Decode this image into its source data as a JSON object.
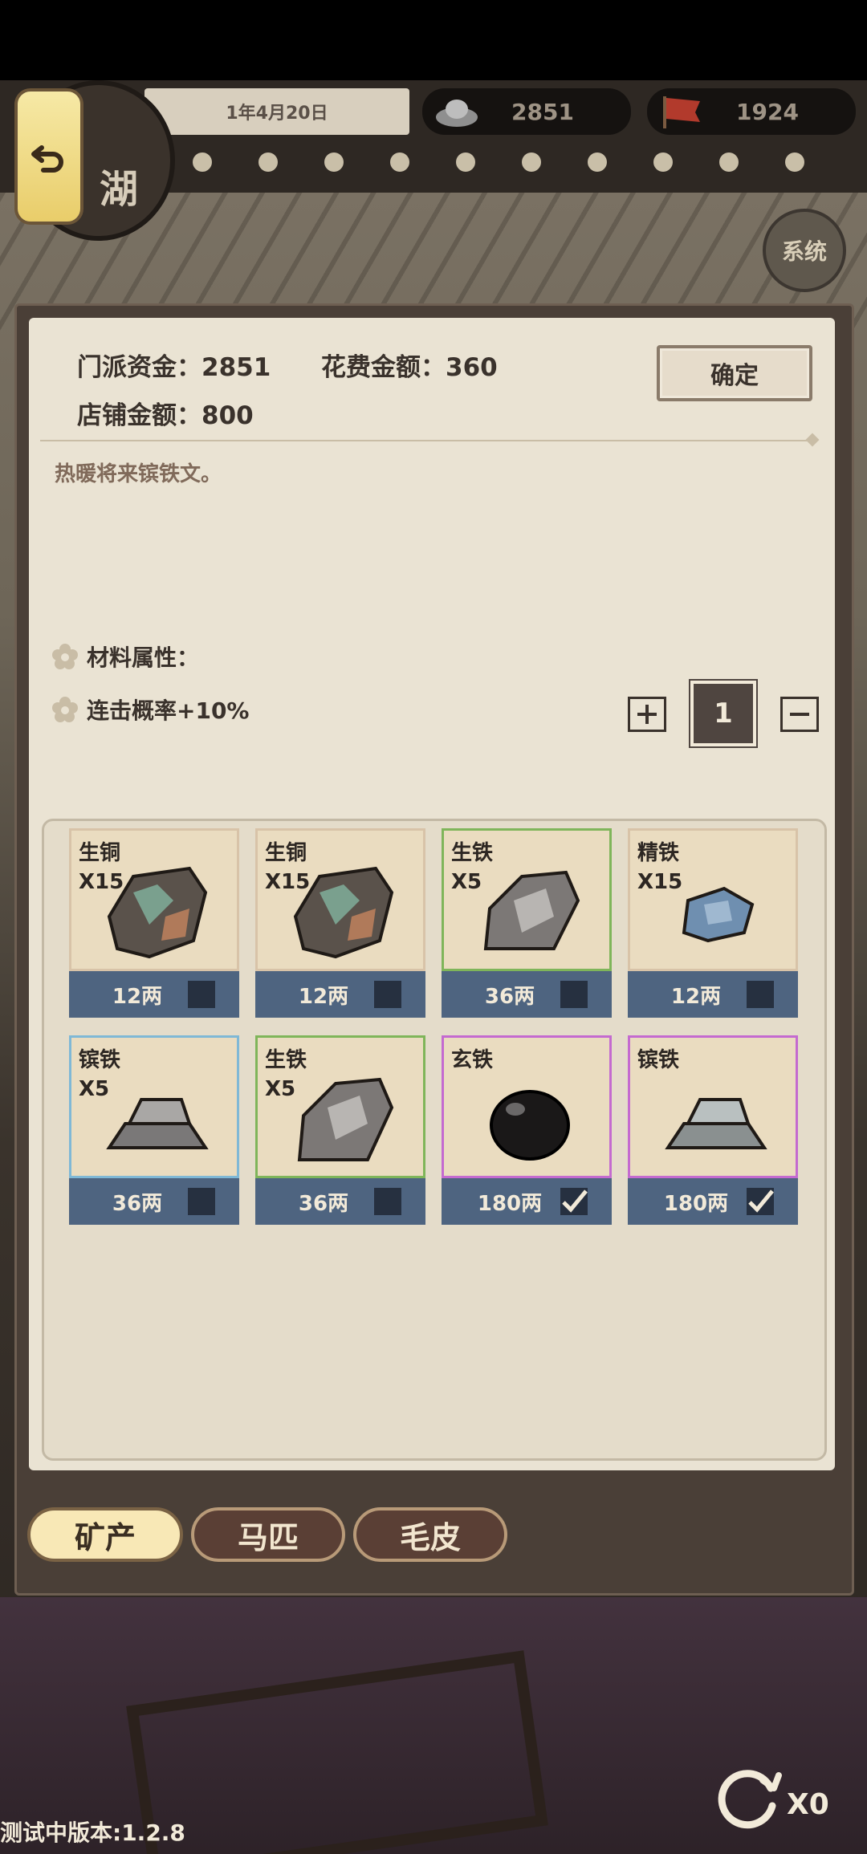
{
  "header": {
    "date": "1年4月20日",
    "silver": "2851",
    "reputation": "1924",
    "back_label": "",
    "emblem_text": "湖",
    "system_label": "系统"
  },
  "panel": {
    "sect_funds_label": "门派资金：",
    "sect_funds": "2851",
    "cost_label": "花费金额：",
    "cost": "360",
    "shop_label": "店铺金额：",
    "shop_amount": "800",
    "confirm_label": "确定",
    "description": "热暖将来镔铁文。",
    "attr_title": "材料属性：",
    "attr_value": "连击概率+10%",
    "quantity": "1"
  },
  "items": [
    {
      "name": "生铜",
      "count": "X15",
      "price": "12两",
      "checked": false,
      "rarity": "white",
      "art": "copper"
    },
    {
      "name": "生铜",
      "count": "X15",
      "price": "12两",
      "checked": false,
      "rarity": "white",
      "art": "copper"
    },
    {
      "name": "生铁",
      "count": "X5",
      "price": "36两",
      "checked": false,
      "rarity": "green",
      "art": "iron"
    },
    {
      "name": "精铁",
      "count": "X15",
      "price": "12两",
      "checked": false,
      "rarity": "white",
      "art": "fine-iron"
    },
    {
      "name": "镔铁",
      "count": "X5",
      "price": "36两",
      "checked": false,
      "rarity": "blue",
      "art": "ingot"
    },
    {
      "name": "生铁",
      "count": "X5",
      "price": "36两",
      "checked": false,
      "rarity": "green",
      "art": "iron"
    },
    {
      "name": "玄铁",
      "count": "",
      "price": "180两",
      "checked": true,
      "rarity": "purple",
      "art": "dark-iron"
    },
    {
      "name": "镔铁",
      "count": "",
      "price": "180两",
      "checked": true,
      "rarity": "purple",
      "art": "ingot"
    }
  ],
  "rarity_colors": {
    "white": "#d8c3a8",
    "green": "#7fb55a",
    "blue": "#7fb8d6",
    "purple": "#c46ad0"
  },
  "tabs": [
    {
      "label": "矿产",
      "active": true
    },
    {
      "label": "马匹",
      "active": false
    },
    {
      "label": "毛皮",
      "active": false
    }
  ],
  "footer": {
    "reroll_count": "X0",
    "version": "测试中版本:1.2.8"
  }
}
